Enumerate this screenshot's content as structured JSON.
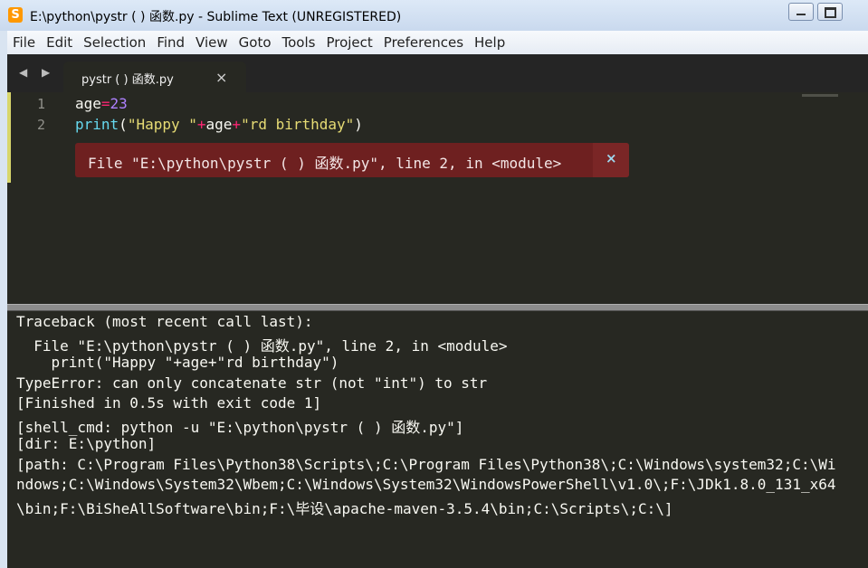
{
  "window": {
    "title": "E:\\python\\pystr ( ) 函数.py - Sublime Text (UNREGISTERED)",
    "app_icon_letter": "S"
  },
  "menu": [
    "File",
    "Edit",
    "Selection",
    "Find",
    "View",
    "Goto",
    "Tools",
    "Project",
    "Preferences",
    "Help"
  ],
  "tabs": {
    "nav_arrows": "◀ ▶",
    "active_label": "pystr ( ) 函数.py",
    "close_glyph": "×"
  },
  "editor": {
    "line_numbers": [
      "1",
      "2"
    ],
    "line1": {
      "ident": "age",
      "op": "=",
      "num": "23"
    },
    "line2": {
      "fn": "print",
      "open": "(",
      "str1": "\"Happy \"",
      "op1": "+",
      "ident": "age",
      "op2": "+",
      "str2": "\"rd birthday\"",
      "close": ")"
    },
    "error_phantom": "File \"E:\\python\\pystr ( ) 函数.py\", line 2, in <module>",
    "error_close": "×"
  },
  "output": [
    "Traceback (most recent call last):",
    "  File \"E:\\python\\pystr ( ) 函数.py\", line 2, in <module>",
    "    print(\"Happy \"+age+\"rd birthday\")",
    "TypeError: can only concatenate str (not \"int\") to str",
    "[Finished in 0.5s with exit code 1]",
    "[shell_cmd: python -u \"E:\\python\\pystr ( ) 函数.py\"]",
    "[dir: E:\\python]",
    "[path: C:\\Program Files\\Python38\\Scripts\\;C:\\Program Files\\Python38\\;C:\\Windows\\system32;C:\\Wi",
    "ndows;C:\\Windows\\System32\\Wbem;C:\\Windows\\System32\\WindowsPowerShell\\v1.0\\;F:\\JDk1.8.0_131_x64",
    "\\bin;F:\\BiSheAllSoftware\\bin;F:\\毕设\\apache-maven-3.5.4\\bin;C:\\Scripts\\;C:\\]"
  ]
}
